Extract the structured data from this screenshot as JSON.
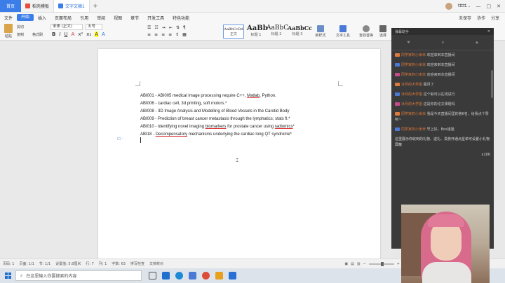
{
  "titlebar": {
    "home_tab": "首页",
    "tabs": [
      {
        "label": "稻壳模板",
        "icon_color": "#e64b3c"
      },
      {
        "label": "文字文稿1",
        "icon_color": "#3b7de9"
      }
    ],
    "right_text": "ttttt...",
    "accent": "#3b7de9"
  },
  "menu": {
    "items": [
      "文件",
      "开始",
      "插入",
      "页面布局",
      "引用",
      "审阅",
      "视图",
      "章节",
      "开发工具",
      "特色功能"
    ],
    "active": "开始",
    "right": [
      "未保存",
      "协作",
      "分享"
    ]
  },
  "ribbon": {
    "paste": "粘贴",
    "cut": "剪切",
    "copy": "复制",
    "format_painter": "格式刷",
    "font_name": "宋体 (正文)",
    "font_size": "五号",
    "styles": [
      {
        "sample": "AaBbCcDd",
        "name": "正文"
      },
      {
        "sample": "AaBb",
        "name": "标题 1"
      },
      {
        "sample": "AaBbC",
        "name": "标题 2"
      },
      {
        "sample": "AaBbCc",
        "name": "标题 3"
      }
    ],
    "new_style": "新样式",
    "text_tools": "文字工具",
    "find_replace": "查找替换",
    "select": "选择"
  },
  "document": {
    "lines": [
      {
        "parts": [
          {
            "t": "ABI001 - ABI005 medical image processing require C++, "
          },
          {
            "t": "Matlab",
            "u": true
          },
          {
            "t": ", Python."
          }
        ]
      },
      {
        "parts": [
          {
            "t": "ABI006 - cardiac cell, 3d printing, soft motors.*"
          }
        ]
      },
      {
        "parts": [
          {
            "t": "ABI008 - 3D Image Analysis and Modelling of Blood Vessels in the Carotid Body"
          }
        ]
      },
      {
        "parts": [
          {
            "t": "ABI009 - Prediction of breast cancer metastasis through the lymphatics; stats fl.*"
          }
        ]
      },
      {
        "parts": [
          {
            "t": "ABI010 - Identifying novel imaging "
          },
          {
            "t": "biomarkers",
            "u": true
          },
          {
            "t": " for prostate cancer using "
          },
          {
            "t": "radiomics",
            "u": true
          },
          {
            "t": "*"
          }
        ]
      },
      {
        "parts": [
          {
            "t": "ABI18 - "
          },
          {
            "t": "Decompensatory",
            "u": true
          },
          {
            "t": " mechanisms underlying the cardiac long QT syndrome*"
          }
        ]
      }
    ]
  },
  "status": {
    "page": "页码: 1",
    "pages": "页面: 1/1",
    "section": "节: 1/1",
    "position": "设置值: 5.8厘米",
    "row": "行: 7",
    "col": "列: 1",
    "words": "字数: 63",
    "spell": "拼写检查",
    "check": "文档校对"
  },
  "taskbar": {
    "search_placeholder": "在这里输入你要搜索的内容",
    "icons": [
      {
        "name": "task-view",
        "color": "#555"
      },
      {
        "name": "mail",
        "color": "#1e6fcf"
      },
      {
        "name": "edge",
        "color": "#1e8ad6"
      },
      {
        "name": "store",
        "color": "#4a7ad6"
      },
      {
        "name": "chrome",
        "color": "#dd4b39"
      },
      {
        "name": "app",
        "color": "#e8a020"
      },
      {
        "name": "wps",
        "color": "#2a6fd6"
      }
    ]
  },
  "live": {
    "header": "弹幕助手",
    "messages": [
      {
        "user": "同学家的小米米",
        "text": "欢迎来到本直播间"
      },
      {
        "user": "同学家的小米米",
        "text": "欢迎来到本直播间"
      },
      {
        "user": "同学家的小米米",
        "text": "欢迎来到本直播间"
      },
      {
        "user": "冰月的大学姐",
        "text": "瓶月了"
      },
      {
        "user": "冰月的大学姐",
        "text": "这个就可以在线进行"
      },
      {
        "user": "冰月的大学姐",
        "text": "这是你的论文课题吗"
      },
      {
        "user": "同学家的小米米",
        "text": "我是今天直播间里的第6名，给我点个赞吧~"
      },
      {
        "user": "同学家的小米米",
        "text": "早上好，Bos姐姐"
      }
    ],
    "gift_notice": "这里展示你收到的礼物、送礼、贵族开通点星单可设置小礼物屏蔽",
    "gift_count": "x100"
  }
}
